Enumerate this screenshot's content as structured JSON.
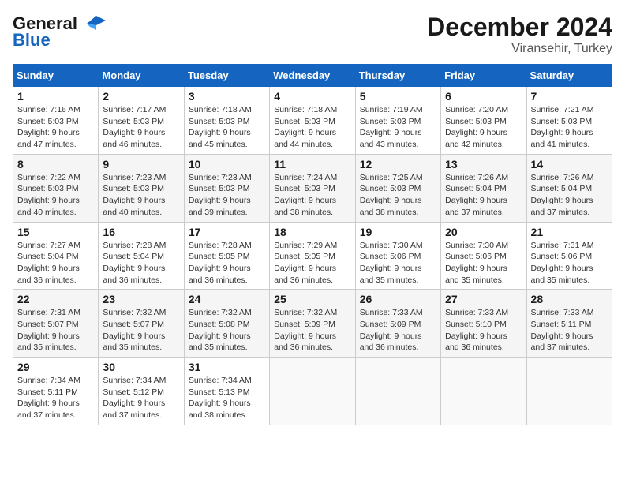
{
  "header": {
    "logo_general": "General",
    "logo_blue": "Blue",
    "month_year": "December 2024",
    "location": "Viransehir, Turkey"
  },
  "days_of_week": [
    "Sunday",
    "Monday",
    "Tuesday",
    "Wednesday",
    "Thursday",
    "Friday",
    "Saturday"
  ],
  "weeks": [
    [
      {
        "day": "1",
        "sunrise": "7:16 AM",
        "sunset": "5:03 PM",
        "daylight": "9 hours and 47 minutes."
      },
      {
        "day": "2",
        "sunrise": "7:17 AM",
        "sunset": "5:03 PM",
        "daylight": "9 hours and 46 minutes."
      },
      {
        "day": "3",
        "sunrise": "7:18 AM",
        "sunset": "5:03 PM",
        "daylight": "9 hours and 45 minutes."
      },
      {
        "day": "4",
        "sunrise": "7:18 AM",
        "sunset": "5:03 PM",
        "daylight": "9 hours and 44 minutes."
      },
      {
        "day": "5",
        "sunrise": "7:19 AM",
        "sunset": "5:03 PM",
        "daylight": "9 hours and 43 minutes."
      },
      {
        "day": "6",
        "sunrise": "7:20 AM",
        "sunset": "5:03 PM",
        "daylight": "9 hours and 42 minutes."
      },
      {
        "day": "7",
        "sunrise": "7:21 AM",
        "sunset": "5:03 PM",
        "daylight": "9 hours and 41 minutes."
      }
    ],
    [
      {
        "day": "8",
        "sunrise": "7:22 AM",
        "sunset": "5:03 PM",
        "daylight": "9 hours and 40 minutes."
      },
      {
        "day": "9",
        "sunrise": "7:23 AM",
        "sunset": "5:03 PM",
        "daylight": "9 hours and 40 minutes."
      },
      {
        "day": "10",
        "sunrise": "7:23 AM",
        "sunset": "5:03 PM",
        "daylight": "9 hours and 39 minutes."
      },
      {
        "day": "11",
        "sunrise": "7:24 AM",
        "sunset": "5:03 PM",
        "daylight": "9 hours and 38 minutes."
      },
      {
        "day": "12",
        "sunrise": "7:25 AM",
        "sunset": "5:03 PM",
        "daylight": "9 hours and 38 minutes."
      },
      {
        "day": "13",
        "sunrise": "7:26 AM",
        "sunset": "5:04 PM",
        "daylight": "9 hours and 37 minutes."
      },
      {
        "day": "14",
        "sunrise": "7:26 AM",
        "sunset": "5:04 PM",
        "daylight": "9 hours and 37 minutes."
      }
    ],
    [
      {
        "day": "15",
        "sunrise": "7:27 AM",
        "sunset": "5:04 PM",
        "daylight": "9 hours and 36 minutes."
      },
      {
        "day": "16",
        "sunrise": "7:28 AM",
        "sunset": "5:04 PM",
        "daylight": "9 hours and 36 minutes."
      },
      {
        "day": "17",
        "sunrise": "7:28 AM",
        "sunset": "5:05 PM",
        "daylight": "9 hours and 36 minutes."
      },
      {
        "day": "18",
        "sunrise": "7:29 AM",
        "sunset": "5:05 PM",
        "daylight": "9 hours and 36 minutes."
      },
      {
        "day": "19",
        "sunrise": "7:30 AM",
        "sunset": "5:06 PM",
        "daylight": "9 hours and 35 minutes."
      },
      {
        "day": "20",
        "sunrise": "7:30 AM",
        "sunset": "5:06 PM",
        "daylight": "9 hours and 35 minutes."
      },
      {
        "day": "21",
        "sunrise": "7:31 AM",
        "sunset": "5:06 PM",
        "daylight": "9 hours and 35 minutes."
      }
    ],
    [
      {
        "day": "22",
        "sunrise": "7:31 AM",
        "sunset": "5:07 PM",
        "daylight": "9 hours and 35 minutes."
      },
      {
        "day": "23",
        "sunrise": "7:32 AM",
        "sunset": "5:07 PM",
        "daylight": "9 hours and 35 minutes."
      },
      {
        "day": "24",
        "sunrise": "7:32 AM",
        "sunset": "5:08 PM",
        "daylight": "9 hours and 35 minutes."
      },
      {
        "day": "25",
        "sunrise": "7:32 AM",
        "sunset": "5:09 PM",
        "daylight": "9 hours and 36 minutes."
      },
      {
        "day": "26",
        "sunrise": "7:33 AM",
        "sunset": "5:09 PM",
        "daylight": "9 hours and 36 minutes."
      },
      {
        "day": "27",
        "sunrise": "7:33 AM",
        "sunset": "5:10 PM",
        "daylight": "9 hours and 36 minutes."
      },
      {
        "day": "28",
        "sunrise": "7:33 AM",
        "sunset": "5:11 PM",
        "daylight": "9 hours and 37 minutes."
      }
    ],
    [
      {
        "day": "29",
        "sunrise": "7:34 AM",
        "sunset": "5:11 PM",
        "daylight": "9 hours and 37 minutes."
      },
      {
        "day": "30",
        "sunrise": "7:34 AM",
        "sunset": "5:12 PM",
        "daylight": "9 hours and 37 minutes."
      },
      {
        "day": "31",
        "sunrise": "7:34 AM",
        "sunset": "5:13 PM",
        "daylight": "9 hours and 38 minutes."
      },
      null,
      null,
      null,
      null
    ]
  ]
}
